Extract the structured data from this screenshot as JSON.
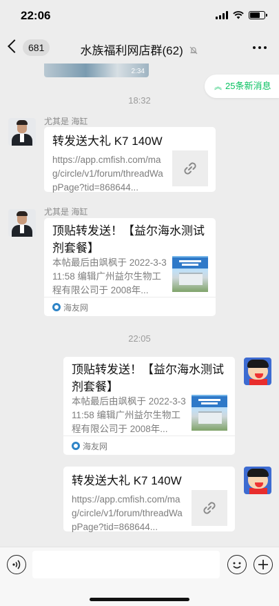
{
  "status_bar": {
    "time": "22:06"
  },
  "header": {
    "unread_count": "681",
    "title": "水族福利网店群(62)"
  },
  "image_message": {
    "duration": "2:34"
  },
  "new_messages_pill": {
    "label": "25条新消息"
  },
  "messages": [
    {
      "time": "18:32",
      "sender": "尤其是 海缸",
      "title": "转发送大礼 K7 140W",
      "description": "https://app.cmfish.com/mag/circle/v1/forum/threadWapPage?tid=868644..."
    },
    {
      "sender": "尤其是 海缸",
      "title": "顶贴转发送！【益尔海水测试剂套餐】",
      "description": "本帖最后由飒枫于 2022-3-311:58 编辑广州益尔生物工程有限公司于 2008年...",
      "source": "海友网"
    },
    {
      "time": "22:05",
      "title": "顶贴转发送！【益尔海水测试剂套餐】",
      "description": "本帖最后由飒枫于 2022-3-311:58 编辑广州益尔生物工程有限公司于 2008年...",
      "source": "海友网"
    },
    {
      "title": "转发送大礼 K7 140W",
      "description": "https://app.cmfish.com/mag/circle/v1/forum/threadWapPage?tid=868644..."
    }
  ]
}
